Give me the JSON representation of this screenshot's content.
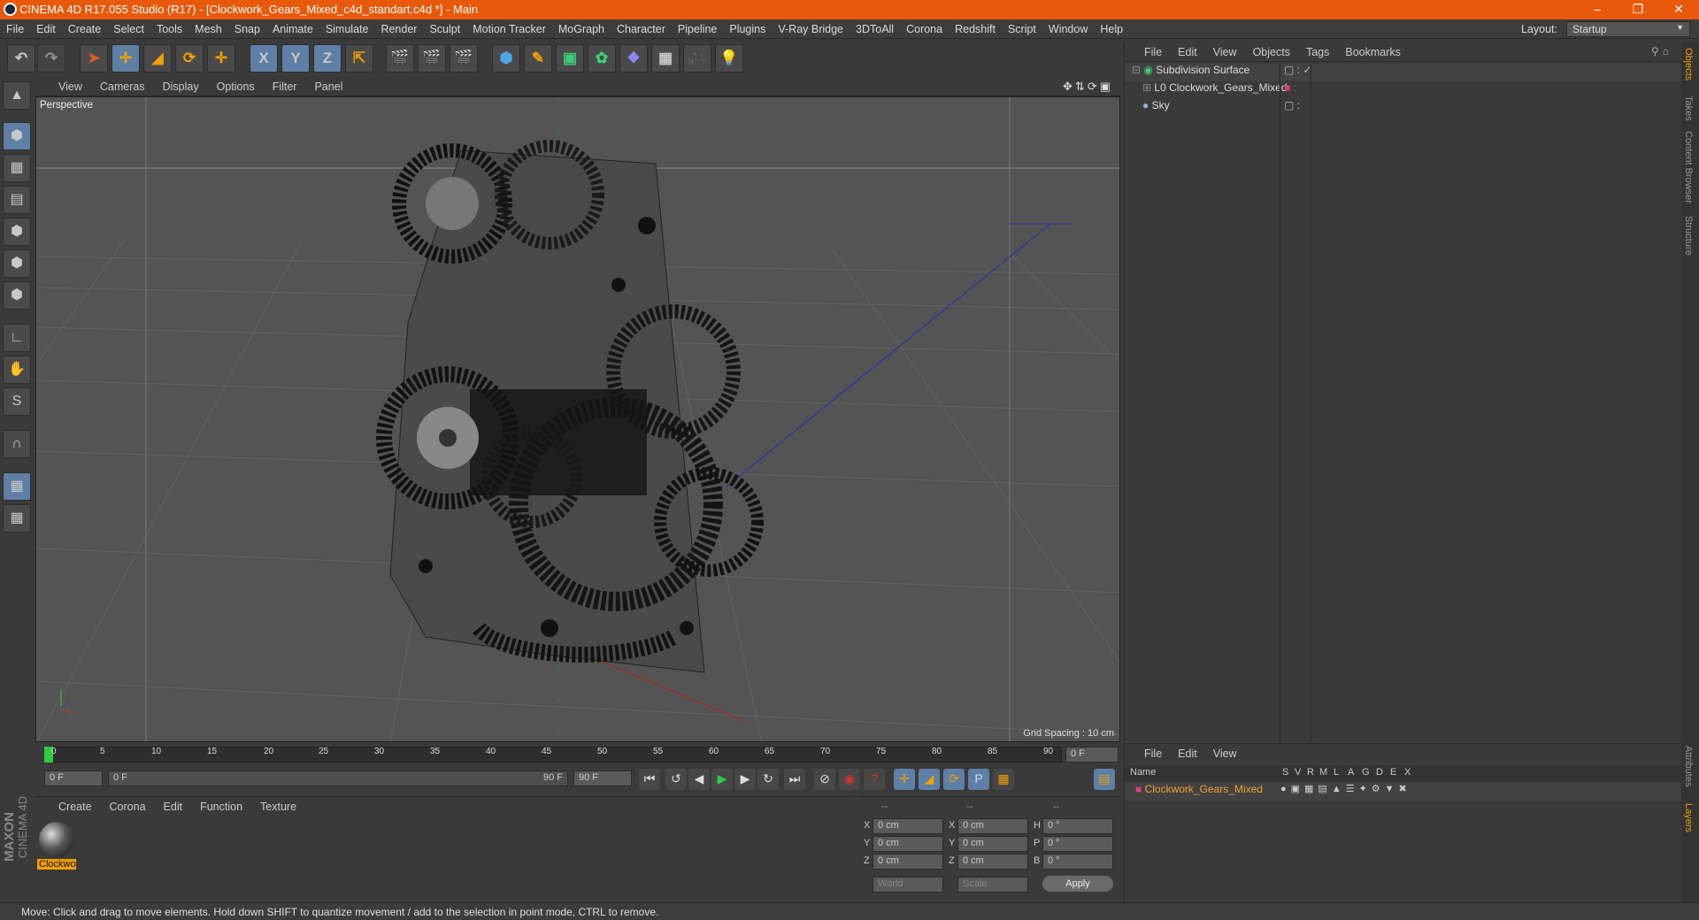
{
  "window": {
    "title": "CINEMA 4D R17.055 Studio (R17) - [Clockwork_Gears_Mixed_c4d_standart.c4d *] - Main",
    "controls": [
      "minimize-icon",
      "restore-icon",
      "close-icon"
    ]
  },
  "menubar": {
    "items": [
      "File",
      "Edit",
      "Create",
      "Select",
      "Tools",
      "Mesh",
      "Snap",
      "Animate",
      "Simulate",
      "Render",
      "Sculpt",
      "Motion Tracker",
      "MoGraph",
      "Character",
      "Pipeline",
      "Plugins",
      "V-Ray Bridge",
      "3DToAll",
      "Corona",
      "Redshift",
      "Script",
      "Window",
      "Help"
    ],
    "layout_label": "Layout:",
    "layout_value": "Startup"
  },
  "toolbar": {
    "buttons": [
      "undo-icon",
      "redo-icon",
      "select-icon",
      "move-icon",
      "scale-icon",
      "rotate-icon",
      "move-alt-icon",
      "x-axis",
      "y-axis",
      "z-axis",
      "world-coord-icon",
      "render-view-icon",
      "render-picture-queue-icon",
      "render-settings-icon",
      "cube-icon",
      "pen-icon",
      "subdiv-icon",
      "cloner-icon",
      "deformer-icon",
      "floor-icon",
      "camera-icon",
      "light-icon"
    ],
    "axis_labels": [
      "X",
      "Y",
      "Z"
    ]
  },
  "left_tools": [
    "model-mode-icon",
    "object-mode-icon",
    "texture-mode-icon",
    "workplane-icon",
    "points-icon",
    "edges-icon",
    "polygons-icon",
    "axis-icon",
    "tweak-icon",
    "soft-selection-icon",
    "magnet-icon",
    "snap-icon",
    "lock-icon"
  ],
  "viewport": {
    "menu": [
      "View",
      "Cameras",
      "Display",
      "Options",
      "Filter",
      "Panel"
    ],
    "label": "Perspective",
    "grid_spacing": "Grid Spacing : 10 cm"
  },
  "timeline": {
    "ticks": [
      "0",
      "5",
      "10",
      "15",
      "20",
      "25",
      "30",
      "35",
      "40",
      "45",
      "50",
      "55",
      "60",
      "65",
      "70",
      "75",
      "80",
      "85",
      "90"
    ],
    "current_frame": "0 F",
    "start_field": "0 F",
    "range_start": "0 F",
    "range_end": "90 F",
    "end_field": "90 F"
  },
  "material_manager": {
    "menu": [
      "Create",
      "Corona",
      "Edit",
      "Function",
      "Texture"
    ],
    "materials": [
      {
        "name": "Clockwo"
      }
    ]
  },
  "coord_manager": {
    "headers": [
      "--",
      "--",
      "--"
    ],
    "rows": [
      {
        "a": "X",
        "av": "0 cm",
        "b": "X",
        "bv": "0 cm",
        "c": "H",
        "cv": "0 °"
      },
      {
        "a": "Y",
        "av": "0 cm",
        "b": "Y",
        "bv": "0 cm",
        "c": "P",
        "cv": "0 °"
      },
      {
        "a": "Z",
        "av": "0 cm",
        "b": "Z",
        "bv": "0 cm",
        "c": "B",
        "cv": "0 °"
      }
    ],
    "mode1": "World",
    "mode2": "Scale",
    "apply": "Apply"
  },
  "object_manager": {
    "menu": [
      "File",
      "Edit",
      "View",
      "Objects",
      "Tags",
      "Bookmarks"
    ],
    "objects": [
      {
        "name": "Subdivision Surface",
        "icon": "subdivision-icon"
      },
      {
        "name": "Clockwork_Gears_Mixed",
        "icon": "null-icon"
      },
      {
        "name": "Sky",
        "icon": "sky-icon"
      }
    ]
  },
  "layer_manager": {
    "menu": [
      "File",
      "Edit",
      "View"
    ],
    "columns": [
      "Name",
      "S",
      "V",
      "R",
      "M",
      "L",
      "A",
      "G",
      "D",
      "E",
      "X"
    ],
    "layers": [
      {
        "name": "Clockwork_Gears_Mixed",
        "color": "#e0407a"
      }
    ]
  },
  "right_tabs": [
    "Objects",
    "Takes",
    "Content Browser",
    "Structure",
    "Attributes",
    "Layers"
  ],
  "status": "Move: Click and drag to move elements. Hold down SHIFT to quantize movement / add to the selection in point mode, CTRL to remove.",
  "branding": {
    "maxon": "MAXON",
    "c4d": "CINEMA 4D"
  },
  "colors": {
    "title_bar": "#e8590c",
    "accent_select": "#5e7fa6",
    "viewport_bg": "#545454",
    "layer_text": "#f0a030"
  }
}
